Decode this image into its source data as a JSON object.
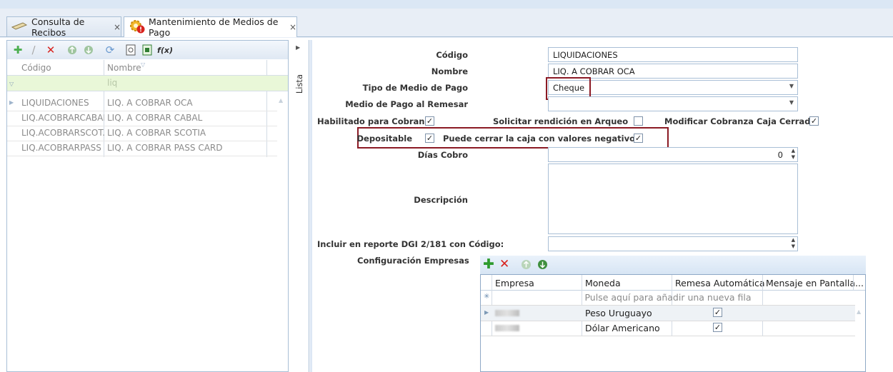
{
  "tabs": [
    {
      "label": "Consulta de Recibos",
      "close": "×",
      "icon": "receipt-icon"
    },
    {
      "label": "Mantenimiento de Medios de Pago",
      "close": "×",
      "icon": "gear-warning-icon"
    }
  ],
  "left_grid": {
    "toolbar_icons": [
      "add-icon",
      "edit-icon",
      "delete-icon",
      "prev-icon",
      "next-icon",
      "refresh-icon",
      "preview-icon",
      "export-icon",
      "function-icon"
    ],
    "columns": [
      "Código",
      "Nombre"
    ],
    "filter_value": "liq",
    "rows": [
      {
        "codigo": "LIQUIDACIONES",
        "nombre": "LIQ. A COBRAR OCA"
      },
      {
        "codigo": "LIQ.ACOBRARCABAL",
        "nombre": "LIQ. A COBRAR CABAL"
      },
      {
        "codigo": "LIQ.ACOBRARSCOT...",
        "nombre": "LIQ. A COBRAR SCOTIA"
      },
      {
        "codigo": "LIQ.ACOBRARPASS",
        "nombre": "LIQ. A COBRAR PASS CARD"
      }
    ]
  },
  "side_label": "Lista",
  "form": {
    "codigo_label": "Código",
    "codigo_value": "LIQUIDACIONES",
    "nombre_label": "Nombre",
    "nombre_value": "LIQ. A COBRAR OCA",
    "tipo_label": "Tipo de Medio de Pago",
    "tipo_value": "Cheque",
    "medio_remesar_label": "Medio de Pago al Remesar",
    "medio_remesar_value": "",
    "habilitado_label": "Habilitado para Cobranza",
    "habilitado_checked": true,
    "solicitar_label": "Solicitar rendición en Arqueo",
    "solicitar_checked": false,
    "modificar_label": "Modificar Cobranza Caja Cerrada",
    "modificar_checked": true,
    "depositable_label": "Depositable",
    "depositable_checked": true,
    "cerrar_label": "Puede cerrar la caja con valores negativos",
    "cerrar_checked": true,
    "dias_label": "Días Cobro",
    "dias_value": "0",
    "descripcion_label": "Descripción",
    "descripcion_value": "",
    "dgi_label": "Incluir en reporte DGI 2/181 con Código:",
    "dgi_value": "",
    "config_label": "Configuración Empresas"
  },
  "config_grid": {
    "toolbar_icons": [
      "add-icon",
      "delete-icon",
      "prev-icon",
      "next-icon"
    ],
    "columns": [
      "Empresa",
      "Moneda",
      "Remesa Automática",
      "Mensaje en Pantalla..."
    ],
    "new_row_text": "Pulse aquí para añadir una nueva fila",
    "rows": [
      {
        "moneda": "Peso Uruguayo",
        "remesa": true
      },
      {
        "moneda": "Dólar Americano",
        "remesa": true
      }
    ]
  },
  "colors": {
    "accent_red": "#8b1a24",
    "filter_green": "#e9f7d8",
    "border_blue": "#a9bfd6"
  }
}
